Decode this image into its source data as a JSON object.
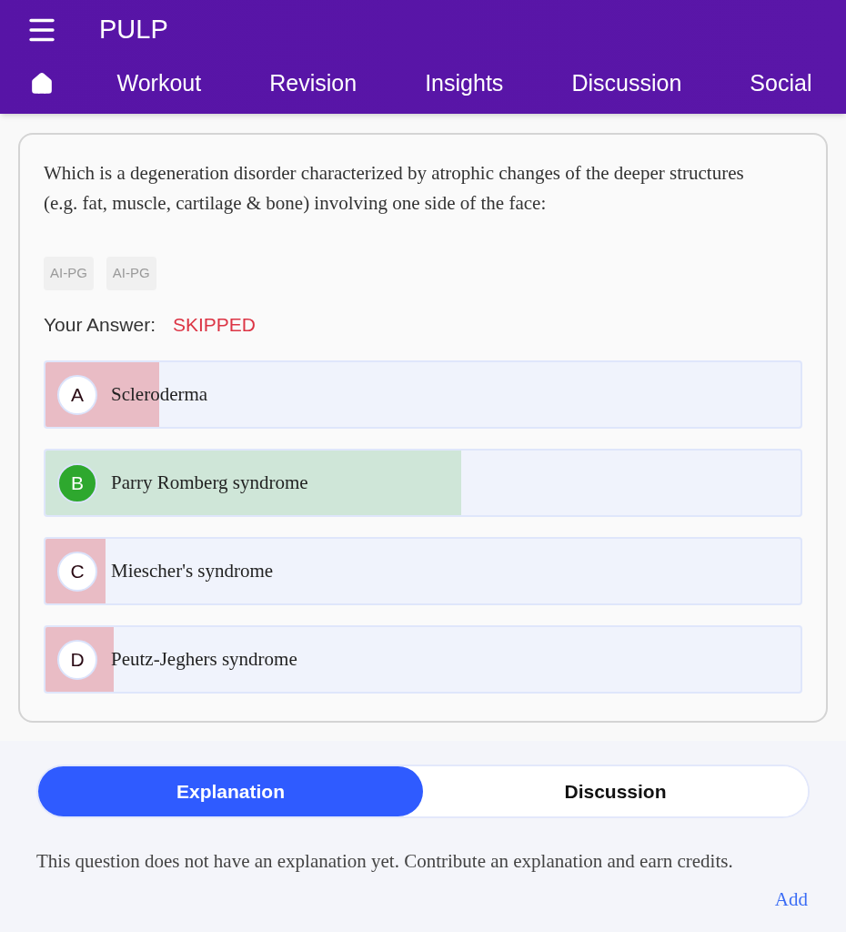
{
  "app": {
    "title": "PULP"
  },
  "nav": [
    {
      "label": "Workout",
      "selected": false
    },
    {
      "label": "Revision",
      "selected": false
    },
    {
      "label": "Insights",
      "selected": false
    },
    {
      "label": "Discussion",
      "selected": false
    },
    {
      "label": "Social",
      "selected": false
    }
  ],
  "question": {
    "text": "Which is a degeneration disorder characterized by atrophic changes of the deeper structures (e.g. fat, muscle, cartilage & bone) involving one side of the face:",
    "tags": [
      "AI-PG",
      "AI-PG"
    ],
    "answer_label": "Your Answer:",
    "answer_value": "SKIPPED",
    "options": [
      {
        "letter": "A",
        "text": "Scleroderma",
        "correct": false,
        "level": 0.15
      },
      {
        "letter": "B",
        "text": "Parry Romberg syndrome",
        "correct": true,
        "level": 0.55
      },
      {
        "letter": "C",
        "text": "Miescher's syndrome",
        "correct": false,
        "level": 0.08
      },
      {
        "letter": "D",
        "text": "Peutz-Jeghers syndrome",
        "correct": false,
        "level": 0.09
      }
    ]
  },
  "tabs": [
    {
      "label": "Explanation",
      "selected": true
    },
    {
      "label": "Discussion",
      "selected": false
    }
  ],
  "explanation": {
    "text": "This question does not have an explanation yet. Contribute an explanation and earn credits.",
    "link": "Add"
  }
}
